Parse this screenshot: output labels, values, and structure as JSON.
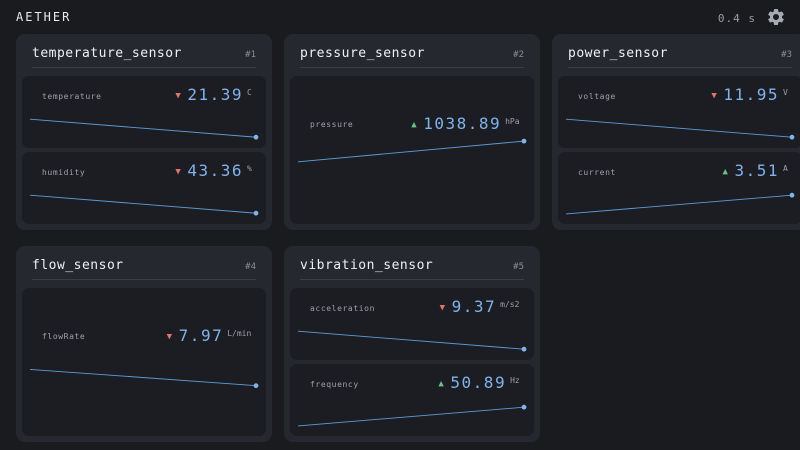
{
  "app": {
    "title": "AETHER",
    "refresh_interval": "0.4 s",
    "settings_icon": "gear-icon"
  },
  "colors": {
    "background": "#1a1b1f",
    "card": "#262830",
    "panel": "#1c1d23",
    "value": "#7fb3ec",
    "trend_down": "#e0766a",
    "trend_up": "#6cc08a",
    "sparkline": "#5e9bd6"
  },
  "sensors": [
    {
      "name": "temperature_sensor",
      "index": "#1",
      "metrics": [
        {
          "label": "temperature",
          "value": "21.39",
          "unit": "C",
          "trend": "down",
          "trend_icon": "arrow-down-icon"
        },
        {
          "label": "humidity",
          "value": "43.36",
          "unit": "%",
          "trend": "down",
          "trend_icon": "arrow-down-icon"
        }
      ]
    },
    {
      "name": "pressure_sensor",
      "index": "#2",
      "metrics": [
        {
          "label": "pressure",
          "value": "1038.89",
          "unit": "hPa",
          "trend": "up",
          "trend_icon": "arrow-up-icon"
        }
      ]
    },
    {
      "name": "power_sensor",
      "index": "#3",
      "metrics": [
        {
          "label": "voltage",
          "value": "11.95",
          "unit": "V",
          "trend": "down",
          "trend_icon": "arrow-down-icon"
        },
        {
          "label": "current",
          "value": "3.51",
          "unit": "A",
          "trend": "up",
          "trend_icon": "arrow-up-icon"
        }
      ]
    },
    {
      "name": "flow_sensor",
      "index": "#4",
      "metrics": [
        {
          "label": "flowRate",
          "value": "7.97",
          "unit": "L/min",
          "trend": "down",
          "trend_icon": "arrow-down-icon"
        }
      ]
    },
    {
      "name": "vibration_sensor",
      "index": "#5",
      "metrics": [
        {
          "label": "acceleration",
          "value": "9.37",
          "unit": "m/s2",
          "trend": "down",
          "trend_icon": "arrow-down-icon"
        },
        {
          "label": "frequency",
          "value": "50.89",
          "unit": "Hz",
          "trend": "up",
          "trend_icon": "arrow-up-icon"
        }
      ]
    }
  ]
}
